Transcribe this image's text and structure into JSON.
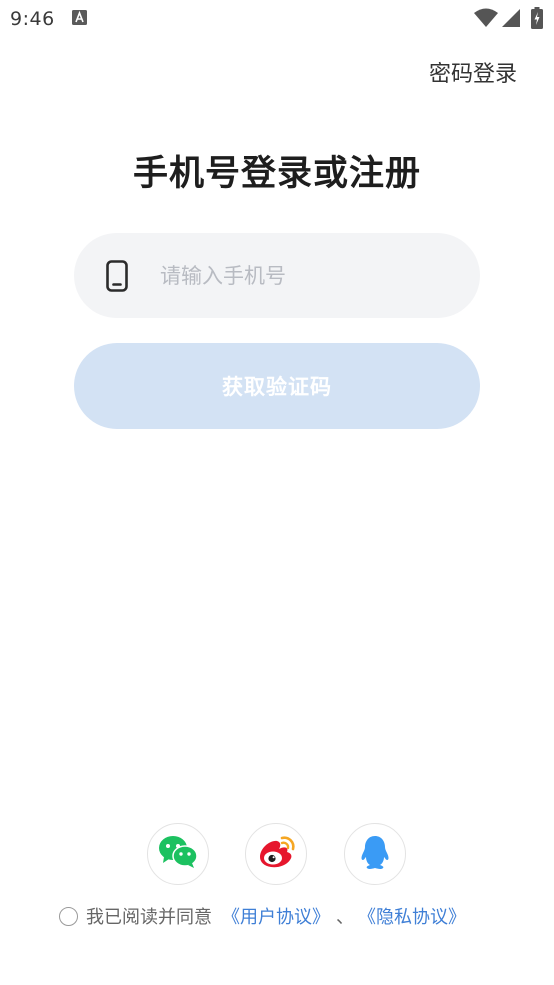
{
  "status_bar": {
    "time": "9:46",
    "icons": [
      "app-notification-icon",
      "wifi-icon",
      "signal-icon",
      "battery-icon"
    ]
  },
  "header": {
    "password_login_label": "密码登录"
  },
  "title": "手机号登录或注册",
  "phone_field": {
    "icon": "phone-icon",
    "placeholder": "请输入手机号",
    "value": ""
  },
  "get_code_button": {
    "label": "获取验证码",
    "enabled": false
  },
  "social_login": [
    {
      "name": "wechat",
      "icon": "wechat-icon",
      "color": "#1cc160"
    },
    {
      "name": "weibo",
      "icon": "weibo-icon",
      "color": "#e6162d"
    },
    {
      "name": "qq",
      "icon": "qq-icon",
      "color": "#3a9bf5"
    }
  ],
  "agreement": {
    "checked": false,
    "text": "我已阅读并同意",
    "user_agreement": "《用户协议》",
    "separator": "、",
    "privacy_policy": "《隐私协议》"
  },
  "colors": {
    "accent_link": "#3f7fd6",
    "button_disabled": "#d3e2f4",
    "field_background": "#f3f4f6"
  }
}
